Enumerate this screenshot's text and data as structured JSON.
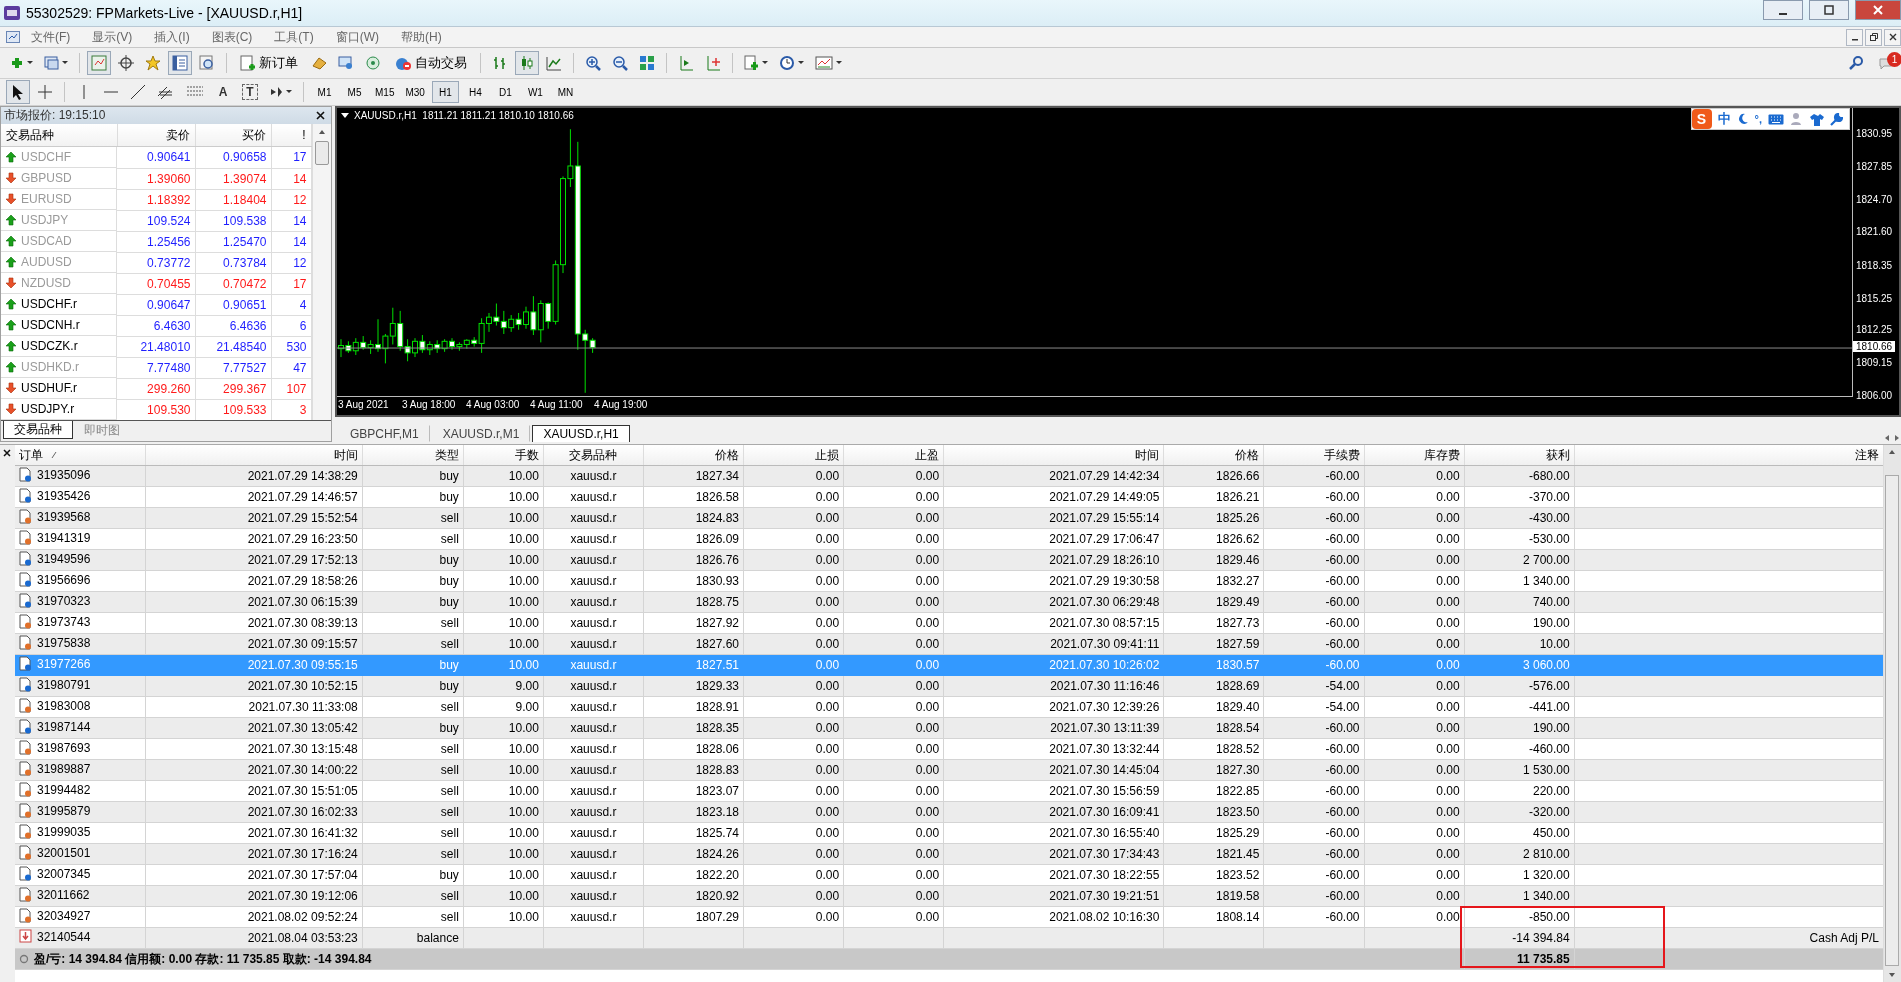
{
  "window": {
    "title": "55302529: FPMarkets-Live - [XAUUSD.r,H1]"
  },
  "menu": [
    "文件(F)",
    "显示(V)",
    "插入(I)",
    "图表(C)",
    "工具(T)",
    "窗口(W)",
    "帮助(H)"
  ],
  "toolbar": {
    "new_order": "新订单",
    "auto_trading": "自动交易",
    "chart_types": [
      {
        "selected": false
      },
      {
        "selected": true
      },
      {
        "selected": false
      }
    ],
    "badge": "1"
  },
  "draw_tools": {
    "cursor_selected": true,
    "text_tool": "A",
    "label_tool": "T"
  },
  "periods": [
    {
      "label": "M1",
      "selected": false
    },
    {
      "label": "M5",
      "selected": false
    },
    {
      "label": "M15",
      "selected": false
    },
    {
      "label": "M30",
      "selected": false
    },
    {
      "label": "H1",
      "selected": true
    },
    {
      "label": "H4",
      "selected": false
    },
    {
      "label": "D1",
      "selected": false
    },
    {
      "label": "W1",
      "selected": false
    },
    {
      "label": "MN",
      "selected": false
    }
  ],
  "market_watch": {
    "title": "市场报价: 19:15:10",
    "columns": [
      "交易品种",
      "卖价",
      "买价",
      "!"
    ],
    "rows": [
      {
        "symbol": "USDCHF",
        "bid": "0.90641",
        "ask": "0.90658",
        "spread": "17",
        "kind": "up",
        "dimmed": true
      },
      {
        "symbol": "GBPUSD",
        "bid": "1.39060",
        "ask": "1.39074",
        "spread": "14",
        "kind": "down",
        "dimmed": true
      },
      {
        "symbol": "EURUSD",
        "bid": "1.18392",
        "ask": "1.18404",
        "spread": "12",
        "kind": "down",
        "dimmed": true
      },
      {
        "symbol": "USDJPY",
        "bid": "109.524",
        "ask": "109.538",
        "spread": "14",
        "kind": "up",
        "dimmed": true
      },
      {
        "symbol": "USDCAD",
        "bid": "1.25456",
        "ask": "1.25470",
        "spread": "14",
        "kind": "up",
        "dimmed": true
      },
      {
        "symbol": "AUDUSD",
        "bid": "0.73772",
        "ask": "0.73784",
        "spread": "12",
        "kind": "up",
        "dimmed": true
      },
      {
        "symbol": "NZDUSD",
        "bid": "0.70455",
        "ask": "0.70472",
        "spread": "17",
        "kind": "down",
        "dimmed": true
      },
      {
        "symbol": "USDCHF.r",
        "bid": "0.90647",
        "ask": "0.90651",
        "spread": "4",
        "kind": "up",
        "dimmed": false
      },
      {
        "symbol": "USDCNH.r",
        "bid": "6.4630",
        "ask": "6.4636",
        "spread": "6",
        "kind": "up",
        "dimmed": false
      },
      {
        "symbol": "USDCZK.r",
        "bid": "21.48010",
        "ask": "21.48540",
        "spread": "530",
        "kind": "up",
        "dimmed": false
      },
      {
        "symbol": "USDHKD.r",
        "bid": "7.77480",
        "ask": "7.77527",
        "spread": "47",
        "kind": "up",
        "dimmed": true
      },
      {
        "symbol": "USDHUF.r",
        "bid": "299.260",
        "ask": "299.367",
        "spread": "107",
        "kind": "down",
        "dimmed": false
      },
      {
        "symbol": "USDJPY.r",
        "bid": "109.530",
        "ask": "109.533",
        "spread": "3",
        "kind": "down",
        "dimmed": false
      }
    ],
    "tabs": [
      {
        "label": "交易品种",
        "selected": true
      },
      {
        "label": "即时图",
        "selected": false
      }
    ]
  },
  "chart": {
    "header": "XAUUSD.r,H1  1811.21 1811.21 1810.10 1810.66",
    "price_axis": [
      "1830.95",
      "1827.85",
      "1824.70",
      "1821.60",
      "1818.35",
      "1815.25",
      "1812.25",
      "1809.15",
      "1806.00"
    ],
    "current_price": "1810.66",
    "time_axis": [
      "3 Aug 2021",
      "3 Aug 18:00",
      "4 Aug 03:00",
      "4 Aug 11:00",
      "4 Aug 19:00"
    ]
  },
  "ime_bar": {
    "logo": "S",
    "mode": "中",
    "punctuation": "°,"
  },
  "chart_tabs": [
    {
      "label": "GBPCHF,M1",
      "selected": false
    },
    {
      "label": "XAUUSD.r,M1",
      "selected": false
    },
    {
      "label": "XAUUSD.r,H1",
      "selected": true
    }
  ],
  "history": {
    "columns": [
      "订单",
      "时间",
      "类型",
      "手数",
      "交易品种",
      "价格",
      "止损",
      "止盈",
      "时间",
      "价格",
      "手续费",
      "库存费",
      "获利",
      "注释"
    ],
    "rows": [
      {
        "kind": "buy",
        "selected": false,
        "order": "31935096",
        "open_time": "2021.07.29 14:38:29",
        "type": "buy",
        "lots": "10.00",
        "symbol": "xauusd.r",
        "open_price": "1827.34",
        "sl": "0.00",
        "tp": "0.00",
        "close_time": "2021.07.29 14:42:34",
        "close_price": "1826.66",
        "commission": "-60.00",
        "swap": "0.00",
        "profit": "-680.00"
      },
      {
        "kind": "buy",
        "selected": false,
        "order": "31935426",
        "open_time": "2021.07.29 14:46:57",
        "type": "buy",
        "lots": "10.00",
        "symbol": "xauusd.r",
        "open_price": "1826.58",
        "sl": "0.00",
        "tp": "0.00",
        "close_time": "2021.07.29 14:49:05",
        "close_price": "1826.21",
        "commission": "-60.00",
        "swap": "0.00",
        "profit": "-370.00"
      },
      {
        "kind": "sell",
        "selected": false,
        "order": "31939568",
        "open_time": "2021.07.29 15:52:54",
        "type": "sell",
        "lots": "10.00",
        "symbol": "xauusd.r",
        "open_price": "1824.83",
        "sl": "0.00",
        "tp": "0.00",
        "close_time": "2021.07.29 15:55:14",
        "close_price": "1825.26",
        "commission": "-60.00",
        "swap": "0.00",
        "profit": "-430.00"
      },
      {
        "kind": "sell",
        "selected": false,
        "order": "31941319",
        "open_time": "2021.07.29 16:23:50",
        "type": "sell",
        "lots": "10.00",
        "symbol": "xauusd.r",
        "open_price": "1826.09",
        "sl": "0.00",
        "tp": "0.00",
        "close_time": "2021.07.29 17:06:47",
        "close_price": "1826.62",
        "commission": "-60.00",
        "swap": "0.00",
        "profit": "-530.00"
      },
      {
        "kind": "buy",
        "selected": false,
        "order": "31949596",
        "open_time": "2021.07.29 17:52:13",
        "type": "buy",
        "lots": "10.00",
        "symbol": "xauusd.r",
        "open_price": "1826.76",
        "sl": "0.00",
        "tp": "0.00",
        "close_time": "2021.07.29 18:26:10",
        "close_price": "1829.46",
        "commission": "-60.00",
        "swap": "0.00",
        "profit": "2 700.00"
      },
      {
        "kind": "buy",
        "selected": false,
        "order": "31956696",
        "open_time": "2021.07.29 18:58:26",
        "type": "buy",
        "lots": "10.00",
        "symbol": "xauusd.r",
        "open_price": "1830.93",
        "sl": "0.00",
        "tp": "0.00",
        "close_time": "2021.07.29 19:30:58",
        "close_price": "1832.27",
        "commission": "-60.00",
        "swap": "0.00",
        "profit": "1 340.00"
      },
      {
        "kind": "buy",
        "selected": false,
        "order": "31970323",
        "open_time": "2021.07.30 06:15:39",
        "type": "buy",
        "lots": "10.00",
        "symbol": "xauusd.r",
        "open_price": "1828.75",
        "sl": "0.00",
        "tp": "0.00",
        "close_time": "2021.07.30 06:29:48",
        "close_price": "1829.49",
        "commission": "-60.00",
        "swap": "0.00",
        "profit": "740.00"
      },
      {
        "kind": "sell",
        "selected": false,
        "order": "31973743",
        "open_time": "2021.07.30 08:39:13",
        "type": "sell",
        "lots": "10.00",
        "symbol": "xauusd.r",
        "open_price": "1827.92",
        "sl": "0.00",
        "tp": "0.00",
        "close_time": "2021.07.30 08:57:15",
        "close_price": "1827.73",
        "commission": "-60.00",
        "swap": "0.00",
        "profit": "190.00"
      },
      {
        "kind": "sell",
        "selected": false,
        "order": "31975838",
        "open_time": "2021.07.30 09:15:57",
        "type": "sell",
        "lots": "10.00",
        "symbol": "xauusd.r",
        "open_price": "1827.60",
        "sl": "0.00",
        "tp": "0.00",
        "close_time": "2021.07.30 09:41:11",
        "close_price": "1827.59",
        "commission": "-60.00",
        "swap": "0.00",
        "profit": "10.00"
      },
      {
        "kind": "buy",
        "selected": true,
        "order": "31977266",
        "open_time": "2021.07.30 09:55:15",
        "type": "buy",
        "lots": "10.00",
        "symbol": "xauusd.r",
        "open_price": "1827.51",
        "sl": "0.00",
        "tp": "0.00",
        "close_time": "2021.07.30 10:26:02",
        "close_price": "1830.57",
        "commission": "-60.00",
        "swap": "0.00",
        "profit": "3 060.00"
      },
      {
        "kind": "buy",
        "selected": false,
        "order": "31980791",
        "open_time": "2021.07.30 10:52:15",
        "type": "buy",
        "lots": "9.00",
        "symbol": "xauusd.r",
        "open_price": "1829.33",
        "sl": "0.00",
        "tp": "0.00",
        "close_time": "2021.07.30 11:16:46",
        "close_price": "1828.69",
        "commission": "-54.00",
        "swap": "0.00",
        "profit": "-576.00"
      },
      {
        "kind": "sell",
        "selected": false,
        "order": "31983008",
        "open_time": "2021.07.30 11:33:08",
        "type": "sell",
        "lots": "9.00",
        "symbol": "xauusd.r",
        "open_price": "1828.91",
        "sl": "0.00",
        "tp": "0.00",
        "close_time": "2021.07.30 12:39:26",
        "close_price": "1829.40",
        "commission": "-54.00",
        "swap": "0.00",
        "profit": "-441.00"
      },
      {
        "kind": "buy",
        "selected": false,
        "order": "31987144",
        "open_time": "2021.07.30 13:05:42",
        "type": "buy",
        "lots": "10.00",
        "symbol": "xauusd.r",
        "open_price": "1828.35",
        "sl": "0.00",
        "tp": "0.00",
        "close_time": "2021.07.30 13:11:39",
        "close_price": "1828.54",
        "commission": "-60.00",
        "swap": "0.00",
        "profit": "190.00"
      },
      {
        "kind": "sell",
        "selected": false,
        "order": "31987693",
        "open_time": "2021.07.30 13:15:48",
        "type": "sell",
        "lots": "10.00",
        "symbol": "xauusd.r",
        "open_price": "1828.06",
        "sl": "0.00",
        "tp": "0.00",
        "close_time": "2021.07.30 13:32:44",
        "close_price": "1828.52",
        "commission": "-60.00",
        "swap": "0.00",
        "profit": "-460.00"
      },
      {
        "kind": "sell",
        "selected": false,
        "order": "31989887",
        "open_time": "2021.07.30 14:00:22",
        "type": "sell",
        "lots": "10.00",
        "symbol": "xauusd.r",
        "open_price": "1828.83",
        "sl": "0.00",
        "tp": "0.00",
        "close_time": "2021.07.30 14:45:04",
        "close_price": "1827.30",
        "commission": "-60.00",
        "swap": "0.00",
        "profit": "1 530.00"
      },
      {
        "kind": "sell",
        "selected": false,
        "order": "31994482",
        "open_time": "2021.07.30 15:51:05",
        "type": "sell",
        "lots": "10.00",
        "symbol": "xauusd.r",
        "open_price": "1823.07",
        "sl": "0.00",
        "tp": "0.00",
        "close_time": "2021.07.30 15:56:59",
        "close_price": "1822.85",
        "commission": "-60.00",
        "swap": "0.00",
        "profit": "220.00"
      },
      {
        "kind": "sell",
        "selected": false,
        "order": "31995879",
        "open_time": "2021.07.30 16:02:33",
        "type": "sell",
        "lots": "10.00",
        "symbol": "xauusd.r",
        "open_price": "1823.18",
        "sl": "0.00",
        "tp": "0.00",
        "close_time": "2021.07.30 16:09:41",
        "close_price": "1823.50",
        "commission": "-60.00",
        "swap": "0.00",
        "profit": "-320.00"
      },
      {
        "kind": "sell",
        "selected": false,
        "order": "31999035",
        "open_time": "2021.07.30 16:41:32",
        "type": "sell",
        "lots": "10.00",
        "symbol": "xauusd.r",
        "open_price": "1825.74",
        "sl": "0.00",
        "tp": "0.00",
        "close_time": "2021.07.30 16:55:40",
        "close_price": "1825.29",
        "commission": "-60.00",
        "swap": "0.00",
        "profit": "450.00"
      },
      {
        "kind": "sell",
        "selected": false,
        "order": "32001501",
        "open_time": "2021.07.30 17:16:24",
        "type": "sell",
        "lots": "10.00",
        "symbol": "xauusd.r",
        "open_price": "1824.26",
        "sl": "0.00",
        "tp": "0.00",
        "close_time": "2021.07.30 17:34:43",
        "close_price": "1821.45",
        "commission": "-60.00",
        "swap": "0.00",
        "profit": "2 810.00"
      },
      {
        "kind": "buy",
        "selected": false,
        "order": "32007345",
        "open_time": "2021.07.30 17:57:04",
        "type": "buy",
        "lots": "10.00",
        "symbol": "xauusd.r",
        "open_price": "1822.20",
        "sl": "0.00",
        "tp": "0.00",
        "close_time": "2021.07.30 18:22:55",
        "close_price": "1823.52",
        "commission": "-60.00",
        "swap": "0.00",
        "profit": "1 320.00"
      },
      {
        "kind": "sell",
        "selected": false,
        "order": "32011662",
        "open_time": "2021.07.30 19:12:06",
        "type": "sell",
        "lots": "10.00",
        "symbol": "xauusd.r",
        "open_price": "1820.92",
        "sl": "0.00",
        "tp": "0.00",
        "close_time": "2021.07.30 19:21:51",
        "close_price": "1819.58",
        "commission": "-60.00",
        "swap": "0.00",
        "profit": "1 340.00"
      },
      {
        "kind": "sell",
        "selected": false,
        "order": "32034927",
        "open_time": "2021.08.02 09:52:24",
        "type": "sell",
        "lots": "10.00",
        "symbol": "xauusd.r",
        "open_price": "1807.29",
        "sl": "0.00",
        "tp": "0.00",
        "close_time": "2021.08.02 10:16:30",
        "close_price": "1808.14",
        "commission": "-60.00",
        "swap": "0.00",
        "profit": "-850.00"
      },
      {
        "kind": "balance",
        "selected": false,
        "order": "32140544",
        "open_time": "2021.08.04 03:53:23",
        "type": "balance",
        "profit": "-14 394.84",
        "comment": "Cash Adj P/L"
      }
    ],
    "summary": "盈/亏: 14 394.84  信用额: 0.00  存款: 11 735.85  取款: -14 394.84",
    "total": "11 735.85"
  }
}
